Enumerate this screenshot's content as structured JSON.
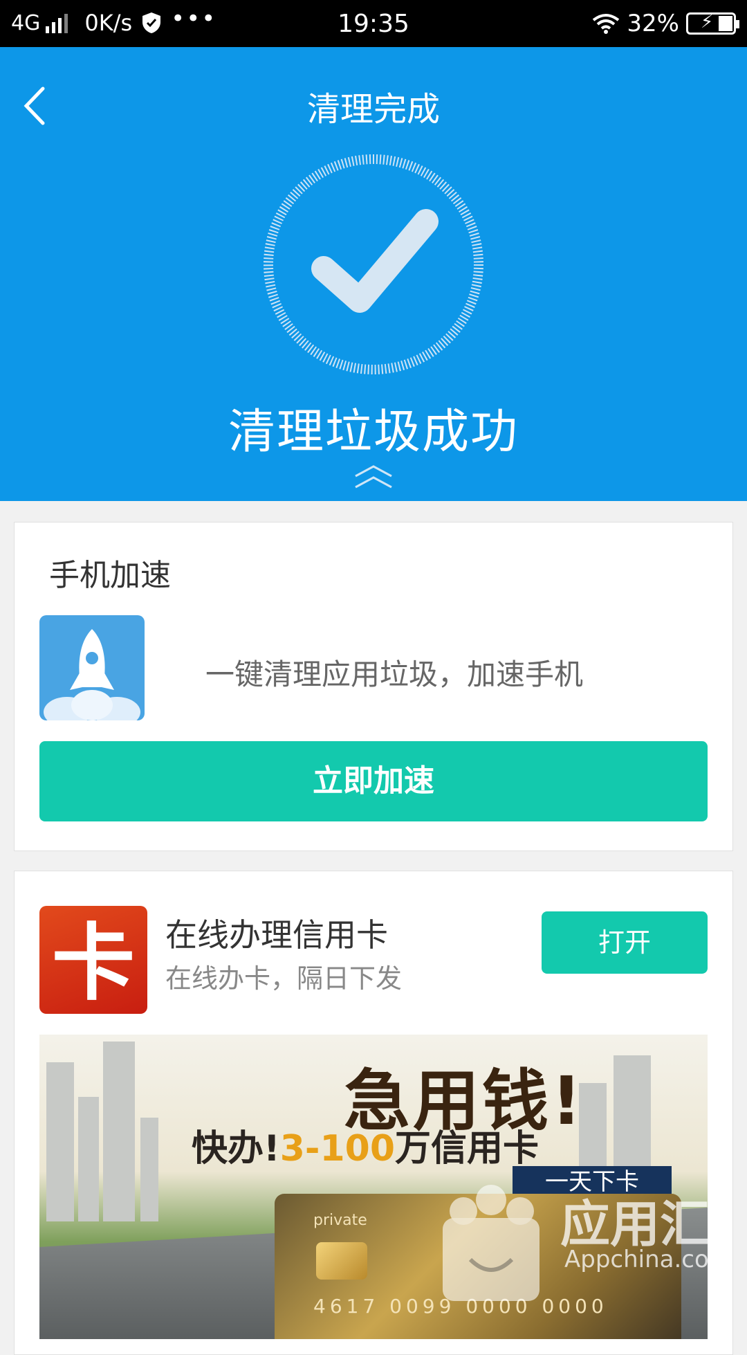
{
  "status_bar": {
    "network": "4G",
    "speed": "0K/s",
    "dots": "•••",
    "time": "19:35",
    "battery": "32%"
  },
  "header": {
    "title": "清理完成",
    "success_text": "清理垃圾成功"
  },
  "accelerate_card": {
    "title": "手机加速",
    "description": "一键清理应用垃圾，加速手机",
    "button_label": "立即加速"
  },
  "ad_card": {
    "app_name": "在线办理信用卡",
    "app_subtitle": "在线办卡，隔日下发",
    "icon_char": "卡",
    "open_button": "打开",
    "banner": {
      "headline": "急用钱!",
      "subline_prefix": "快办!",
      "subline_highlight": "3-100",
      "subline_suffix": "万信用卡",
      "tag": "一天下卡",
      "card_label": "private",
      "card_number": "4617 0099 0000 0000"
    }
  },
  "watermark": {
    "text": "应用汇",
    "sub": "Appchina.com"
  },
  "colors": {
    "header_bg": "#0d97e8",
    "accent_green": "#13c9ad",
    "page_bg": "#f1f1f1"
  }
}
